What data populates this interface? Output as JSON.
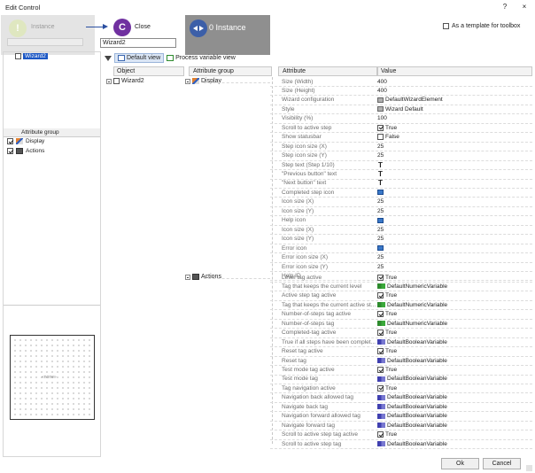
{
  "window": {
    "title": "Edit Control",
    "help": "?",
    "close": "×"
  },
  "template": {
    "label": "As a template for toolbox",
    "checked": false
  },
  "steps": {
    "instance": {
      "label": "Instance",
      "icon": "!"
    },
    "close": {
      "label": "Close",
      "icon": "C",
      "input_value": "Wizard2"
    },
    "instance2": {
      "label": "0 Instance"
    }
  },
  "tree": {
    "item": "Wizard2"
  },
  "attr_groups": {
    "header": "Attribute group",
    "items": [
      {
        "label": "Display",
        "checked": true
      },
      {
        "label": "Actions",
        "checked": true
      }
    ]
  },
  "preview": {
    "label": "«none»"
  },
  "toolbar": {
    "default_view": "Default view",
    "process_view": "Process variable view"
  },
  "grid": {
    "col_object": "Object",
    "col_attrgroup": "Attribute group",
    "col_attribute": "Attribute",
    "col_value": "Value",
    "object": "Wizard2",
    "groups": [
      "Display",
      "Actions"
    ]
  },
  "props": [
    {
      "attr": "Size (Width)",
      "value": "400",
      "icon": ""
    },
    {
      "attr": "Size (Height)",
      "value": "400",
      "icon": ""
    },
    {
      "attr": "Wizard configuration",
      "value": "DefaultWizardElement",
      "icon": "wiz"
    },
    {
      "attr": "Style",
      "value": "Wizard Default",
      "icon": "wiz"
    },
    {
      "attr": "Visibility (%)",
      "value": "100",
      "icon": ""
    },
    {
      "attr": "Scroll to active step",
      "value": "True",
      "icon": "check"
    },
    {
      "attr": "Show statusbar",
      "value": "False",
      "icon": "uncheck"
    },
    {
      "attr": "Step icon size (X)",
      "value": "25",
      "icon": ""
    },
    {
      "attr": "Step icon size (Y)",
      "value": "25",
      "icon": ""
    },
    {
      "attr": "Step text (Step 1/10)",
      "value": "",
      "icon": "text"
    },
    {
      "attr": "\"Previous button\" text",
      "value": "",
      "icon": "text"
    },
    {
      "attr": "\"Next button\" text",
      "value": "",
      "icon": "text"
    },
    {
      "attr": "Completed step icon",
      "value": "",
      "icon": "pic"
    },
    {
      "attr": "Icon size (X)",
      "value": "25",
      "icon": ""
    },
    {
      "attr": "Icon size (Y)",
      "value": "25",
      "icon": ""
    },
    {
      "attr": "Help icon",
      "value": "",
      "icon": "pic"
    },
    {
      "attr": "Icon size (X)",
      "value": "25",
      "icon": ""
    },
    {
      "attr": "Icon size (Y)",
      "value": "25",
      "icon": ""
    },
    {
      "attr": "Error icon",
      "value": "",
      "icon": "pic"
    },
    {
      "attr": "Error icon size (X)",
      "value": "25",
      "icon": ""
    },
    {
      "attr": "Error icon size (Y)",
      "value": "25",
      "icon": ""
    },
    {
      "attr": "Help ID",
      "value": "",
      "icon": ""
    },
    {
      "attr": "Level tag active",
      "value": "True",
      "icon": "check"
    },
    {
      "attr": "Tag that keeps the current level",
      "value": "DefaultNumericVariable",
      "icon": "var"
    },
    {
      "attr": "Active step tag active",
      "value": "True",
      "icon": "check"
    },
    {
      "attr": "Tag that keeps the current active st...",
      "value": "DefaultNumericVariable",
      "icon": "var"
    },
    {
      "attr": "Number-of-steps tag active",
      "value": "True",
      "icon": "check"
    },
    {
      "attr": "Number-of-steps tag",
      "value": "DefaultNumericVariable",
      "icon": "var"
    },
    {
      "attr": "Completed-tag active",
      "value": "True",
      "icon": "check"
    },
    {
      "attr": "True if all steps have been complet...",
      "value": "DefaultBooleanVariable",
      "icon": "boolvar"
    },
    {
      "attr": "Reset tag active",
      "value": "True",
      "icon": "check"
    },
    {
      "attr": "Reset tag",
      "value": "DefaultBooleanVariable",
      "icon": "boolvar"
    },
    {
      "attr": "Test mode tag active",
      "value": "True",
      "icon": "check"
    },
    {
      "attr": "Test mode tag",
      "value": "DefaultBooleanVariable",
      "icon": "boolvar"
    },
    {
      "attr": "Tag navigation active",
      "value": "True",
      "icon": "check"
    },
    {
      "attr": "Navigation back allowed tag",
      "value": "DefaultBooleanVariable",
      "icon": "boolvar"
    },
    {
      "attr": "Navigate back tag",
      "value": "DefaultBooleanVariable",
      "icon": "boolvar"
    },
    {
      "attr": "Navigation forward allowed tag",
      "value": "DefaultBooleanVariable",
      "icon": "boolvar"
    },
    {
      "attr": "Navigate forward tag",
      "value": "DefaultBooleanVariable",
      "icon": "boolvar"
    },
    {
      "attr": "Scroll to active step tag active",
      "value": "True",
      "icon": "check"
    },
    {
      "attr": "Scroll to active step tag",
      "value": "DefaultBooleanVariable",
      "icon": "boolvar"
    }
  ],
  "buttons": {
    "ok": "Ok",
    "cancel": "Cancel"
  }
}
